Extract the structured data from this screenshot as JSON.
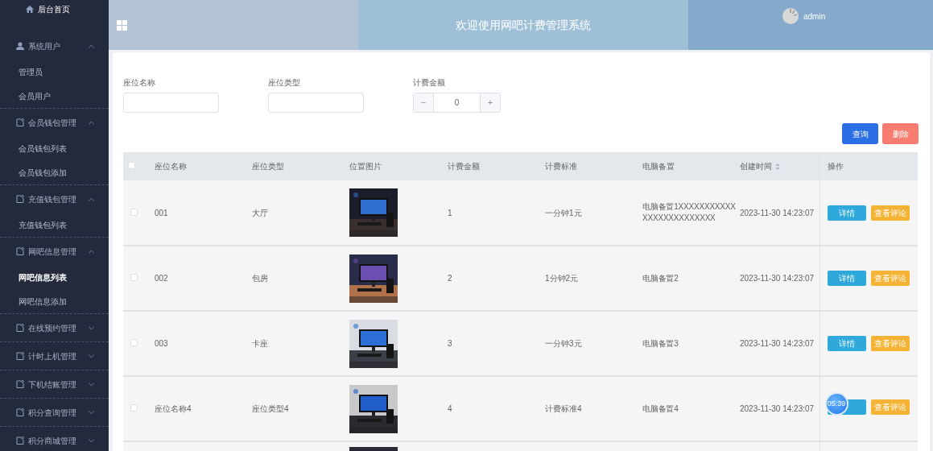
{
  "sidebar": {
    "home": {
      "label": "后台首页"
    },
    "groups": [
      {
        "label": "系统用户",
        "expanded": true,
        "children": [
          {
            "label": "管理员",
            "selected": false
          },
          {
            "label": "会员用户",
            "selected": false
          }
        ]
      },
      {
        "label": "会员钱包管理",
        "expanded": true,
        "children": [
          {
            "label": "会员钱包列表",
            "selected": false
          },
          {
            "label": "会员钱包添加",
            "selected": false
          }
        ]
      },
      {
        "label": "充值钱包管理",
        "expanded": true,
        "children": [
          {
            "label": "充值钱包列表",
            "selected": false
          }
        ]
      },
      {
        "label": "网吧信息管理",
        "expanded": true,
        "children": [
          {
            "label": "网吧信息列表",
            "selected": true
          },
          {
            "label": "网吧信息添加",
            "selected": false
          }
        ]
      },
      {
        "label": "在线预约管理",
        "expanded": false
      },
      {
        "label": "计时上机管理",
        "expanded": false
      },
      {
        "label": "下机结账管理",
        "expanded": false
      },
      {
        "label": "积分查询管理",
        "expanded": false
      },
      {
        "label": "积分商城管理",
        "expanded": false
      }
    ]
  },
  "header": {
    "title": "欢迎使用网吧计费管理系统",
    "user": "admin"
  },
  "search": {
    "fields": [
      {
        "label": "座位名称",
        "kind": "text"
      },
      {
        "label": "座位类型",
        "kind": "text"
      },
      {
        "label": "计费金额",
        "kind": "number",
        "value": "0",
        "minus": "−",
        "plus": "+"
      }
    ],
    "buttons": [
      {
        "label": "查询",
        "kind": "primary"
      },
      {
        "label": "删除",
        "kind": "danger"
      }
    ]
  },
  "table": {
    "select_all": {
      "checked": false
    },
    "columns": [
      {
        "label": "座位名称",
        "sortable": false
      },
      {
        "label": "座位类型",
        "sortable": false
      },
      {
        "label": "位置图片",
        "sortable": false
      },
      {
        "label": "计费金额",
        "sortable": false
      },
      {
        "label": "计费标准",
        "sortable": false
      },
      {
        "label": "电脑备置",
        "sortable": false
      },
      {
        "label": "创建时间",
        "sortable": true
      },
      {
        "label": "操作",
        "sortable": false
      }
    ],
    "rows": [
      {
        "checked": false,
        "seat_name": "001",
        "seat_type": "大厅",
        "picture": {
          "kind": "picture"
        },
        "amount": "1",
        "billing_standard": "一分钟1元",
        "pc_config": "电脑备置1XXXXXXXXXXXXXXXXXXXXXXXXX",
        "created_at": "2023-11-30 14:23:07",
        "actions": [
          {
            "label": "详情",
            "kind": "detail"
          },
          {
            "label": "查看评论",
            "kind": "comments"
          }
        ]
      },
      {
        "checked": false,
        "seat_name": "002",
        "seat_type": "包房",
        "picture": {
          "kind": "picture"
        },
        "amount": "2",
        "billing_standard": "1分钟2元",
        "pc_config": "电脑备置2",
        "created_at": "2023-11-30 14:23:07",
        "actions": [
          {
            "label": "详情",
            "kind": "detail"
          },
          {
            "label": "查看评论",
            "kind": "comments"
          }
        ]
      },
      {
        "checked": false,
        "seat_name": "003",
        "seat_type": "卡座",
        "picture": {
          "kind": "picture"
        },
        "amount": "3",
        "billing_standard": "一分钟3元",
        "pc_config": "电脑备置3",
        "created_at": "2023-11-30 14:23:07",
        "actions": [
          {
            "label": "详情",
            "kind": "detail"
          },
          {
            "label": "查看评论",
            "kind": "comments"
          }
        ]
      },
      {
        "checked": false,
        "seat_name": "座位名称4",
        "seat_type": "座位类型4",
        "picture": {
          "kind": "picture"
        },
        "amount": "4",
        "billing_standard": "计费标准4",
        "pc_config": "电脑备置4",
        "created_at": "2023-11-30 14:23:07",
        "actions": [
          {
            "kind": "detail"
          },
          {
            "label": "查看评论",
            "kind": "comments"
          }
        ]
      },
      {
        "picture": {
          "kind": "picture"
        }
      }
    ]
  },
  "timer_bubble": "05:39"
}
